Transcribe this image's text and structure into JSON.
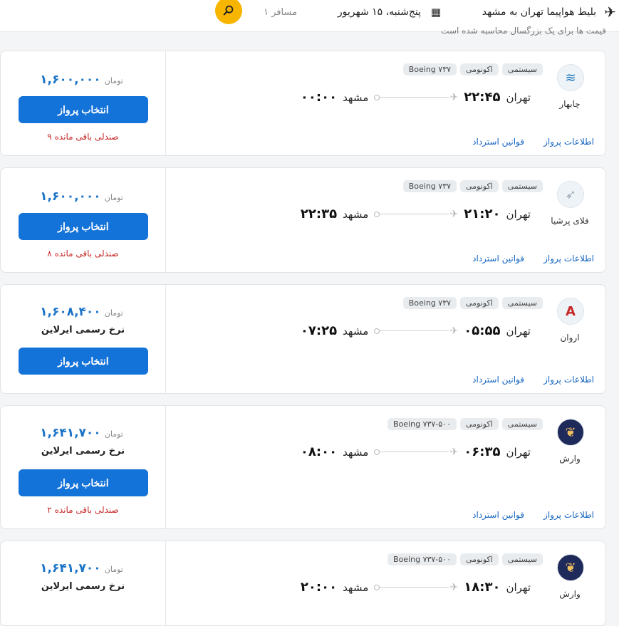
{
  "header": {
    "route_title": "بلیط هواپیما تهران به مشهد",
    "date": "پنج‌شنبه، ۱۵ شهریور",
    "passengers": "۱ مسافر",
    "partial_note": "قیمت ها برای یک بزرگسال محاسبه شده است",
    "icons": {
      "plane": "plane-icon",
      "calendar": "calendar-icon",
      "search": "search-icon"
    }
  },
  "common": {
    "currency": "تومان",
    "select_label": "انتخاب پرواز",
    "flight_info": "اطلاعات پرواز",
    "refund_rules": "قوانین استرداد",
    "official_rate": "نرخ رسمی ایرلاین"
  },
  "flights": [
    {
      "airline": "چابهار",
      "logo_color": "#1b75bb",
      "tags": [
        "سیستمی",
        "اکونومی",
        "Boeing ۷۳۷"
      ],
      "origin": "تهران",
      "dep_time": "۲۲:۴۵",
      "destination": "مشهد",
      "arr_time": "۰۰:۰۰",
      "price": "۱,۶۰۰,۰۰۰",
      "seats": "۹ صندلی باقی مانده"
    },
    {
      "airline": "فلای پرشیا",
      "logo_color": "#9aa5b1",
      "tags": [
        "سیستمی",
        "اکونومی",
        "Boeing ۷۳۷"
      ],
      "origin": "تهران",
      "dep_time": "۲۱:۲۰",
      "destination": "مشهد",
      "arr_time": "۲۲:۳۵",
      "price": "۱,۶۰۰,۰۰۰",
      "seats": "۸ صندلی باقی مانده"
    },
    {
      "airline": "اروان",
      "logo_color": "#c62828",
      "tags": [
        "سیستمی",
        "اکونومی",
        "Boeing ۷۳۷"
      ],
      "origin": "تهران",
      "dep_time": "۰۵:۵۵",
      "destination": "مشهد",
      "arr_time": "۰۷:۲۵",
      "price": "۱,۶۰۸,۴۰۰",
      "official": "نرخ رسمی ایرلاین"
    },
    {
      "airline": "وارش",
      "logo_color": "#1e2a5a",
      "tags": [
        "سیستمی",
        "اکونومی",
        "Boeing ۷۳۷-۵۰۰"
      ],
      "origin": "تهران",
      "dep_time": "۰۶:۳۵",
      "destination": "مشهد",
      "arr_time": "۰۸:۰۰",
      "price": "۱,۶۴۱,۷۰۰",
      "official": "نرخ رسمی ایرلاین",
      "seats": "۲ صندلی باقی مانده"
    },
    {
      "airline": "وارش",
      "logo_color": "#1e2a5a",
      "tags": [
        "سیستمی",
        "اکونومی",
        "Boeing ۷۳۷-۵۰۰"
      ],
      "origin": "تهران",
      "dep_time": "۱۸:۳۰",
      "destination": "مشهد",
      "arr_time": "۲۰:۰۰",
      "price": "۱,۶۴۱,۷۰۰",
      "official": "نرخ رسمی ایرلاین"
    }
  ]
}
